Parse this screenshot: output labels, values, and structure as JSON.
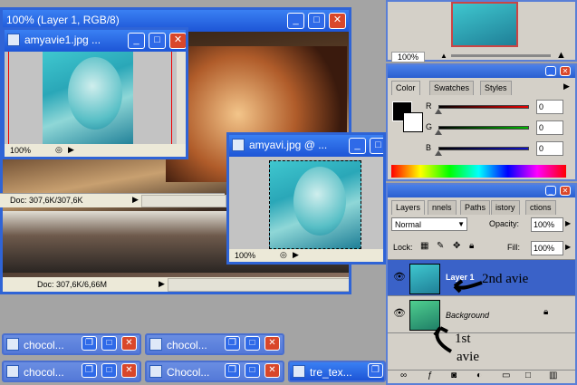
{
  "windows": {
    "main": {
      "title": "100% (Layer 1, RGB/8)",
      "status": "Doc: 307,6K/6,66M"
    },
    "amyavie1": {
      "title": "amyavie1.jpg ...",
      "zoom": "100%",
      "status": "Doc: 307,6K/307,6K"
    },
    "amyavi": {
      "title": "amyavi.jpg @ ...",
      "zoom": "100%"
    }
  },
  "navigator": {
    "zoom": "100%"
  },
  "color_panel": {
    "tabs": [
      "Color",
      "Swatches",
      "Styles"
    ],
    "channels": [
      {
        "label": "R",
        "value": "0"
      },
      {
        "label": "G",
        "value": "0"
      },
      {
        "label": "B",
        "value": "0"
      }
    ]
  },
  "layers_panel": {
    "tabs": [
      "Layers",
      "nnels",
      "Paths",
      "istory",
      "ctions"
    ],
    "blend_mode": "Normal",
    "opacity_label": "Opacity:",
    "opacity_value": "100%",
    "lock_label": "Lock:",
    "fill_label": "Fill:",
    "fill_value": "100%",
    "layers": [
      {
        "name": "Layer 1"
      },
      {
        "name": "Background"
      }
    ]
  },
  "annotations": {
    "second": "2nd avie",
    "first_line1": "1st",
    "first_line2": "avie"
  },
  "taskbar": {
    "items": [
      "chocol...",
      "chocol...",
      "chocol...",
      "Chocol...",
      "tre_tex..."
    ]
  },
  "colors": {
    "accent": "#2f64d6",
    "close": "#d9472a",
    "layer_selected": "#3a62c8"
  }
}
